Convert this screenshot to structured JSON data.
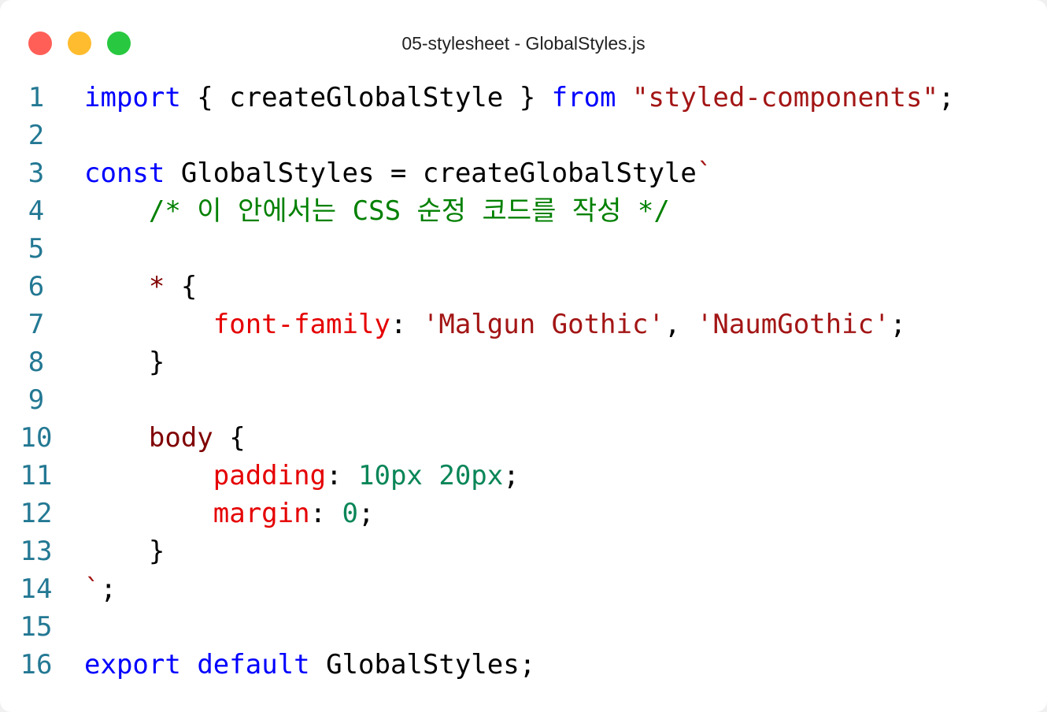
{
  "window": {
    "title": "05-stylesheet - GlobalStyles.js",
    "traffic_lights": {
      "close_color": "#ff5f57",
      "minimize_color": "#febc2e",
      "maximize_color": "#28c840"
    }
  },
  "colors": {
    "keyword": "#0000ff",
    "plain": "#000000",
    "string": "#a31515",
    "comment": "#008000",
    "selector": "#800000",
    "property": "#e50000",
    "number": "#098658",
    "line_number": "#237893"
  },
  "editor": {
    "lines": [
      {
        "number": "1",
        "tokens": [
          {
            "type": "keyword",
            "text": "import"
          },
          {
            "type": "plain",
            "text": " { createGlobalStyle } "
          },
          {
            "type": "keyword",
            "text": "from"
          },
          {
            "type": "plain",
            "text": " "
          },
          {
            "type": "string",
            "text": "\"styled-components\""
          },
          {
            "type": "plain",
            "text": ";"
          }
        ]
      },
      {
        "number": "2",
        "tokens": []
      },
      {
        "number": "3",
        "tokens": [
          {
            "type": "keyword",
            "text": "const"
          },
          {
            "type": "plain",
            "text": " GlobalStyles = createGlobalStyle"
          },
          {
            "type": "string",
            "text": "`"
          }
        ]
      },
      {
        "number": "4",
        "tokens": [
          {
            "type": "plain",
            "text": "    "
          },
          {
            "type": "comment",
            "text": "/* 이 안에서는 CSS 순정 코드를 작성 */"
          }
        ]
      },
      {
        "number": "5",
        "tokens": []
      },
      {
        "number": "6",
        "tokens": [
          {
            "type": "plain",
            "text": "    "
          },
          {
            "type": "selector",
            "text": "*"
          },
          {
            "type": "plain",
            "text": " {"
          }
        ]
      },
      {
        "number": "7",
        "tokens": [
          {
            "type": "plain",
            "text": "        "
          },
          {
            "type": "prop",
            "text": "font-family"
          },
          {
            "type": "plain",
            "text": ": "
          },
          {
            "type": "string",
            "text": "'Malgun Gothic'"
          },
          {
            "type": "plain",
            "text": ", "
          },
          {
            "type": "string",
            "text": "'NaumGothic'"
          },
          {
            "type": "plain",
            "text": ";"
          }
        ]
      },
      {
        "number": "8",
        "tokens": [
          {
            "type": "plain",
            "text": "    }"
          }
        ]
      },
      {
        "number": "9",
        "tokens": []
      },
      {
        "number": "10",
        "tokens": [
          {
            "type": "plain",
            "text": "    "
          },
          {
            "type": "selector",
            "text": "body"
          },
          {
            "type": "plain",
            "text": " {"
          }
        ]
      },
      {
        "number": "11",
        "tokens": [
          {
            "type": "plain",
            "text": "        "
          },
          {
            "type": "prop",
            "text": "padding"
          },
          {
            "type": "plain",
            "text": ": "
          },
          {
            "type": "number",
            "text": "10px 20px"
          },
          {
            "type": "plain",
            "text": ";"
          }
        ]
      },
      {
        "number": "12",
        "tokens": [
          {
            "type": "plain",
            "text": "        "
          },
          {
            "type": "prop",
            "text": "margin"
          },
          {
            "type": "plain",
            "text": ": "
          },
          {
            "type": "number",
            "text": "0"
          },
          {
            "type": "plain",
            "text": ";"
          }
        ]
      },
      {
        "number": "13",
        "tokens": [
          {
            "type": "plain",
            "text": "    }"
          }
        ]
      },
      {
        "number": "14",
        "tokens": [
          {
            "type": "string",
            "text": "`"
          },
          {
            "type": "plain",
            "text": ";"
          }
        ]
      },
      {
        "number": "15",
        "tokens": []
      },
      {
        "number": "16",
        "tokens": [
          {
            "type": "keyword",
            "text": "export"
          },
          {
            "type": "plain",
            "text": " "
          },
          {
            "type": "keyword",
            "text": "default"
          },
          {
            "type": "plain",
            "text": " GlobalStyles;"
          }
        ]
      }
    ]
  }
}
